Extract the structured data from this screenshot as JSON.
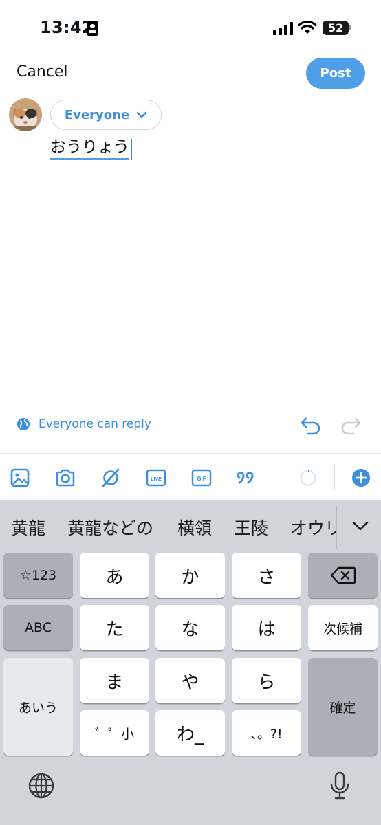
{
  "status_bar": {
    "time": "13:42",
    "battery": "52"
  },
  "header": {
    "cancel_label": "Cancel",
    "post_label": "Post"
  },
  "composer": {
    "audience_label": "Everyone",
    "text": "おうりょう",
    "reply_setting_label": "Everyone can reply"
  },
  "toolbar": {
    "icons": [
      "image-icon",
      "camera-icon",
      "grok-icon",
      "live-icon",
      "gif-icon",
      "quote-icon",
      "progress-ring-icon",
      "add-icon"
    ],
    "live_label": "LIVE",
    "gif_label": "GIF"
  },
  "keyboard": {
    "candidates": [
      "黄龍",
      "黄龍などの",
      "横領",
      "王陵",
      "オウリ"
    ],
    "keys": {
      "num": "☆123",
      "a": "あ",
      "ka": "か",
      "sa": "さ",
      "abc": "ABC",
      "ta": "た",
      "na": "な",
      "ha": "は",
      "next_candidate": "次候補",
      "aiu": "あいう",
      "ma": "ま",
      "ya": "や",
      "ra": "ら",
      "confirm": "確定",
      "dakuten": "゛゜小",
      "wa": "わ_",
      "punct": "、。?!"
    }
  },
  "colors": {
    "accent": "#4f9fe8",
    "keyboard_bg": "#d1d4db",
    "dark_key": "#abafb8"
  }
}
